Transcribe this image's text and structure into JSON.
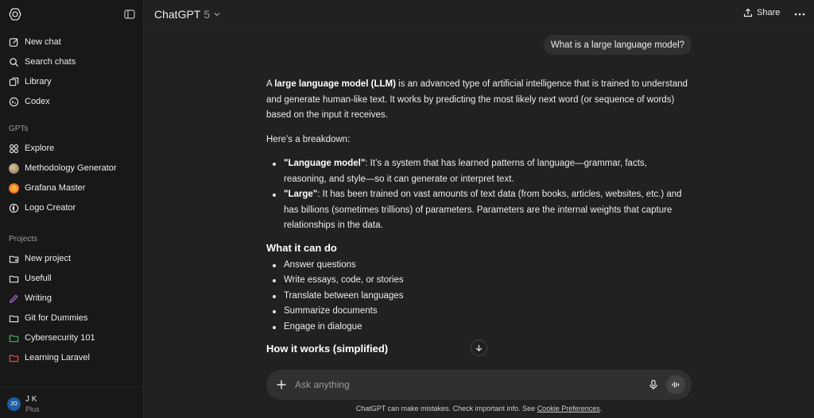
{
  "sidebar": {
    "items": [
      {
        "label": "New chat",
        "icon": "compose-icon"
      },
      {
        "label": "Search chats",
        "icon": "search-icon"
      },
      {
        "label": "Library",
        "icon": "library-icon"
      },
      {
        "label": "Codex",
        "icon": "codex-icon"
      }
    ],
    "gpts_title": "GPTs",
    "gpts": [
      {
        "label": "Explore",
        "icon": "grid-icon"
      },
      {
        "label": "Methodology Generator",
        "icon": "gpt-avatar-icon"
      },
      {
        "label": "Grafana Master",
        "icon": "grafana-icon"
      },
      {
        "label": "Logo Creator",
        "icon": "logo-creator-icon"
      }
    ],
    "projects_title": "Projects",
    "projects": [
      {
        "label": "New project",
        "icon": "folder-plus-icon",
        "color": "#ececec"
      },
      {
        "label": "Usefull",
        "icon": "folder-icon",
        "color": "#ececec"
      },
      {
        "label": "Writing",
        "icon": "pen-icon",
        "color": "#b06ce0"
      },
      {
        "label": "Git for Dummies",
        "icon": "folder-icon",
        "color": "#ececec"
      },
      {
        "label": "Cybersecurity 101",
        "icon": "folder-icon",
        "color": "#3fb950"
      },
      {
        "label": "Learning Laravel",
        "icon": "folder-icon",
        "color": "#e5534b"
      }
    ],
    "user": {
      "initials": "JO",
      "name": "J K",
      "plan": "Plus"
    }
  },
  "header": {
    "model": "ChatGPT",
    "version": "5",
    "share_label": "Share"
  },
  "conversation": {
    "user_message": "What is a large language model?",
    "intro_prefix": "A ",
    "intro_bold": "large language model (LLM)",
    "intro_rest": " is an advanced type of artificial intelligence that is trained to understand and generate human-like text. It works by predicting the most likely next word (or sequence of words) based on the input it receives.",
    "breakdown": "Here’s a breakdown:",
    "bullets": [
      {
        "bold": "\"Language model\"",
        "text": ": It’s a system that has learned patterns of language—grammar, facts, reasoning, and style—so it can generate or interpret text."
      },
      {
        "bold": "\"Large\"",
        "text": ": It has been trained on vast amounts of text data (from books, articles, websites, etc.) and has billions (sometimes trillions) of parameters. Parameters are the internal weights that capture relationships in the data."
      }
    ],
    "can_do_heading": "What it can do",
    "can_do": [
      "Answer questions",
      "Write essays, code, or stories",
      "Translate between languages",
      "Summarize documents",
      "Engage in dialogue"
    ],
    "how_heading": "How it works (simplified)"
  },
  "composer": {
    "placeholder": "Ask anything"
  },
  "footer": {
    "disclaimer": "ChatGPT can make mistakes. Check important info. See ",
    "link": "Cookie Preferences",
    "end": "."
  },
  "colors": {
    "background": "#212121",
    "sidebar": "#181818",
    "bubble": "#303030"
  }
}
